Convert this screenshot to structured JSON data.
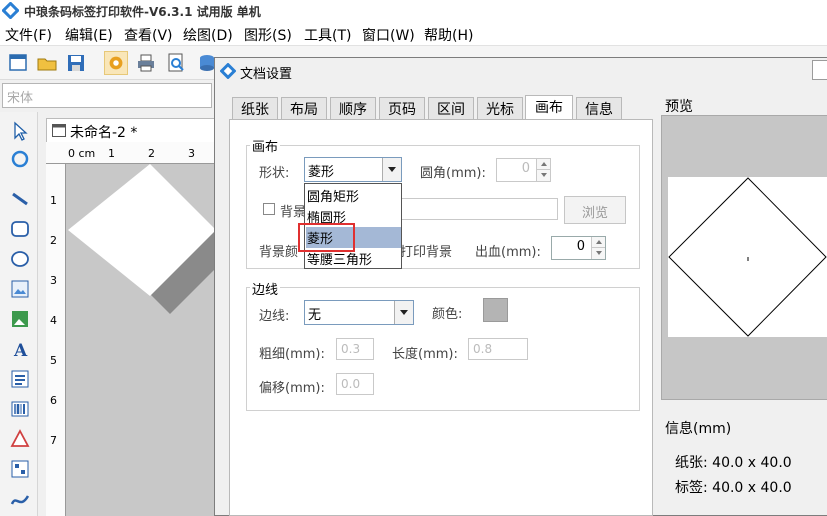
{
  "app": {
    "title": "中琅条码标签打印软件-V6.3.1 试用版 单机",
    "menu": [
      "文件(F)",
      "编辑(E)",
      "查看(V)",
      "绘图(D)",
      "图形(S)",
      "工具(T)",
      "窗口(W)",
      "帮助(H)"
    ],
    "font_placeholder": "宋体",
    "document_tab": "未命名-2 *",
    "ruler_h_labels": [
      "0 cm",
      "1",
      "2",
      "3"
    ],
    "ruler_v_labels": [
      "1",
      "2",
      "3",
      "4",
      "5",
      "6",
      "7"
    ]
  },
  "dialog": {
    "title": "文档设置",
    "tabs": [
      "纸张",
      "布局",
      "顺序",
      "页码",
      "区间",
      "光标",
      "画布",
      "信息"
    ],
    "selected_tab": "画布",
    "canvas_group": {
      "title": "画布",
      "shape_label": "形状:",
      "shape_value": "菱形",
      "corner_label": "圆角(mm):",
      "corner_value": "0",
      "bg_image_label": "背景",
      "browse_label": "浏览",
      "bg_color_label": "背景颜",
      "print_bg_label": "打印背景",
      "bleed_label": "出血(mm):",
      "bleed_value": "0"
    },
    "shape_options": [
      "圆角矩形",
      "椭圆形",
      "菱形",
      "等腰三角形"
    ],
    "border_group": {
      "title": "边线",
      "border_label": "边线:",
      "border_value": "无",
      "color_label": "颜色:",
      "width_label": "粗细(mm):",
      "width_value": "0.3",
      "length_label": "长度(mm):",
      "length_value": "0.8",
      "offset_label": "偏移(mm):",
      "offset_value": "0.0"
    },
    "preview_label": "预览",
    "info_label": "信息(mm)",
    "info_paper": "纸张: 40.0 x 40.0",
    "info_label_size": "标签: 40.0 x 40.0"
  },
  "colors": {
    "highlight": "#a4b8d6",
    "callout_border": "#e03030",
    "border_color_swatch": "#b4b4b4"
  }
}
